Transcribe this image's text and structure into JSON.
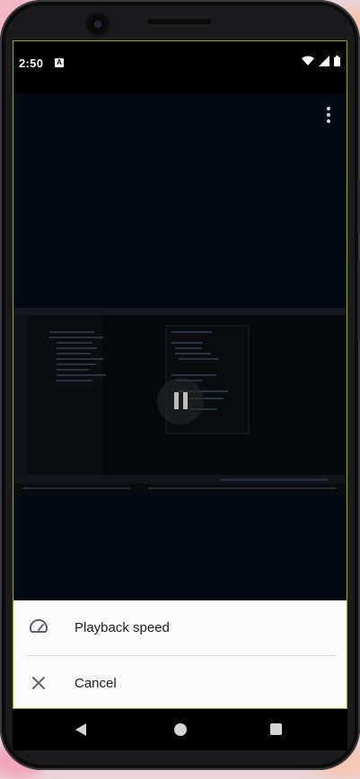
{
  "status_bar": {
    "time": "2:50",
    "notification_badge": "A",
    "icons": [
      "wifi-icon",
      "signal-icon",
      "battery-icon"
    ]
  },
  "player": {
    "menu_icon": "more-vert-icon",
    "state_icon": "pause-icon"
  },
  "bottom_sheet": {
    "items": [
      {
        "icon": "speed-gauge-icon",
        "label": "Playback speed"
      },
      {
        "icon": "close-icon",
        "label": "Cancel"
      }
    ]
  },
  "nav_bar": {
    "buttons": [
      "back-icon",
      "home-icon",
      "recents-icon"
    ]
  },
  "colors": {
    "screen_bg": "#030a14",
    "sheet_bg": "#fafafa",
    "frame_accent": "#8fa61f"
  }
}
